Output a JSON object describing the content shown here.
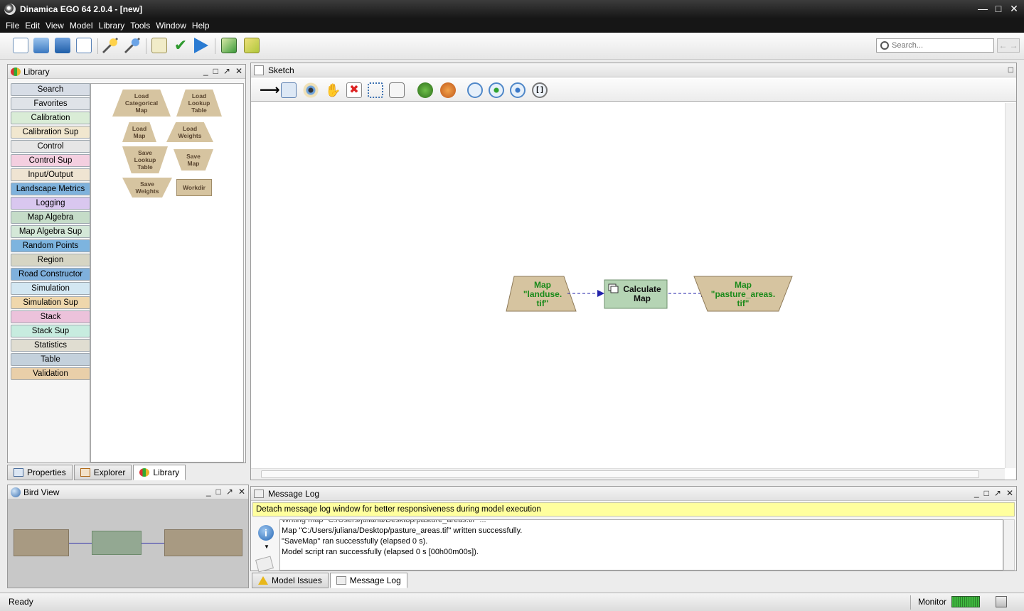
{
  "window": {
    "title": "Dinamica EGO 64 2.0.4 - [new]"
  },
  "menu": [
    "File",
    "Edit",
    "View",
    "Model",
    "Library",
    "Tools",
    "Window",
    "Help"
  ],
  "toolbar": {
    "search_placeholder": "Search..."
  },
  "library": {
    "title": "Library",
    "categories": [
      {
        "label": "Search",
        "color": "#d7dde6"
      },
      {
        "label": "Favorites",
        "color": "#dfe3e8"
      },
      {
        "label": "Calibration",
        "color": "#d9ecd6"
      },
      {
        "label": "Calibration Sup",
        "color": "#f1e7cf"
      },
      {
        "label": "Control",
        "color": "#e6e6e6"
      },
      {
        "label": "Control Sup",
        "color": "#f4cfe0"
      },
      {
        "label": "Input/Output",
        "color": "#efe4d2"
      },
      {
        "label": "Landscape Metrics",
        "color": "#7fb2dc"
      },
      {
        "label": "Logging",
        "color": "#d9c7ef"
      },
      {
        "label": "Map Algebra",
        "color": "#c5dcc8"
      },
      {
        "label": "Map Algebra Sup",
        "color": "#d4e8d8"
      },
      {
        "label": "Random Points",
        "color": "#7db4df"
      },
      {
        "label": "Region",
        "color": "#d6d5c4"
      },
      {
        "label": "Road Constructor",
        "color": "#7fb0dc"
      },
      {
        "label": "Simulation",
        "color": "#d3e7f2"
      },
      {
        "label": "Simulation Sup",
        "color": "#efd7ac"
      },
      {
        "label": "Stack",
        "color": "#ecc2db"
      },
      {
        "label": "Stack Sup",
        "color": "#c7ecdf"
      },
      {
        "label": "Statistics",
        "color": "#e0ddd1"
      },
      {
        "label": "Table",
        "color": "#c4d1dc"
      },
      {
        "label": "Validation",
        "color": "#e9cfa9"
      }
    ],
    "items": {
      "load_categorical_map": "Load Categorical Map",
      "load_lookup_table": "Load Lookup Table",
      "load_map": "Load Map",
      "load_weights": "Load Weights",
      "save_lookup_table": "Save Lookup Table",
      "save_map": "Save Map",
      "save_weights": "Save Weights",
      "workdir": "Workdir"
    }
  },
  "left_tabs": [
    "Properties",
    "Explorer",
    "Library"
  ],
  "bird_view": {
    "title": "Bird View"
  },
  "sketch": {
    "title": "Sketch",
    "nodes": {
      "map_in_line1": "Map",
      "map_in_line2": "\"landuse.",
      "map_in_line3": "tif\"",
      "calc_line1": "Calculate",
      "calc_line2": "Map",
      "map_out_line1": "Map",
      "map_out_line2": "\"pasture_areas.",
      "map_out_line3": "tif\""
    }
  },
  "message_log": {
    "title": "Message Log",
    "banner": "Detach message log window for better responsiveness during model execution",
    "lines": [
      "Writing map \"C:/Users/juliana/Desktop/pasture_areas.tif\" ...",
      "Map \"C:/Users/juliana/Desktop/pasture_areas.tif\" written successfully.",
      "\"SaveMap\" ran successfully (elapsed 0 s).",
      "Model script ran successfully (elapsed 0 s [00h00m00s])."
    ]
  },
  "bottom_tabs": [
    "Model Issues",
    "Message Log"
  ],
  "status": {
    "left": "Ready",
    "monitor": "Monitor"
  }
}
